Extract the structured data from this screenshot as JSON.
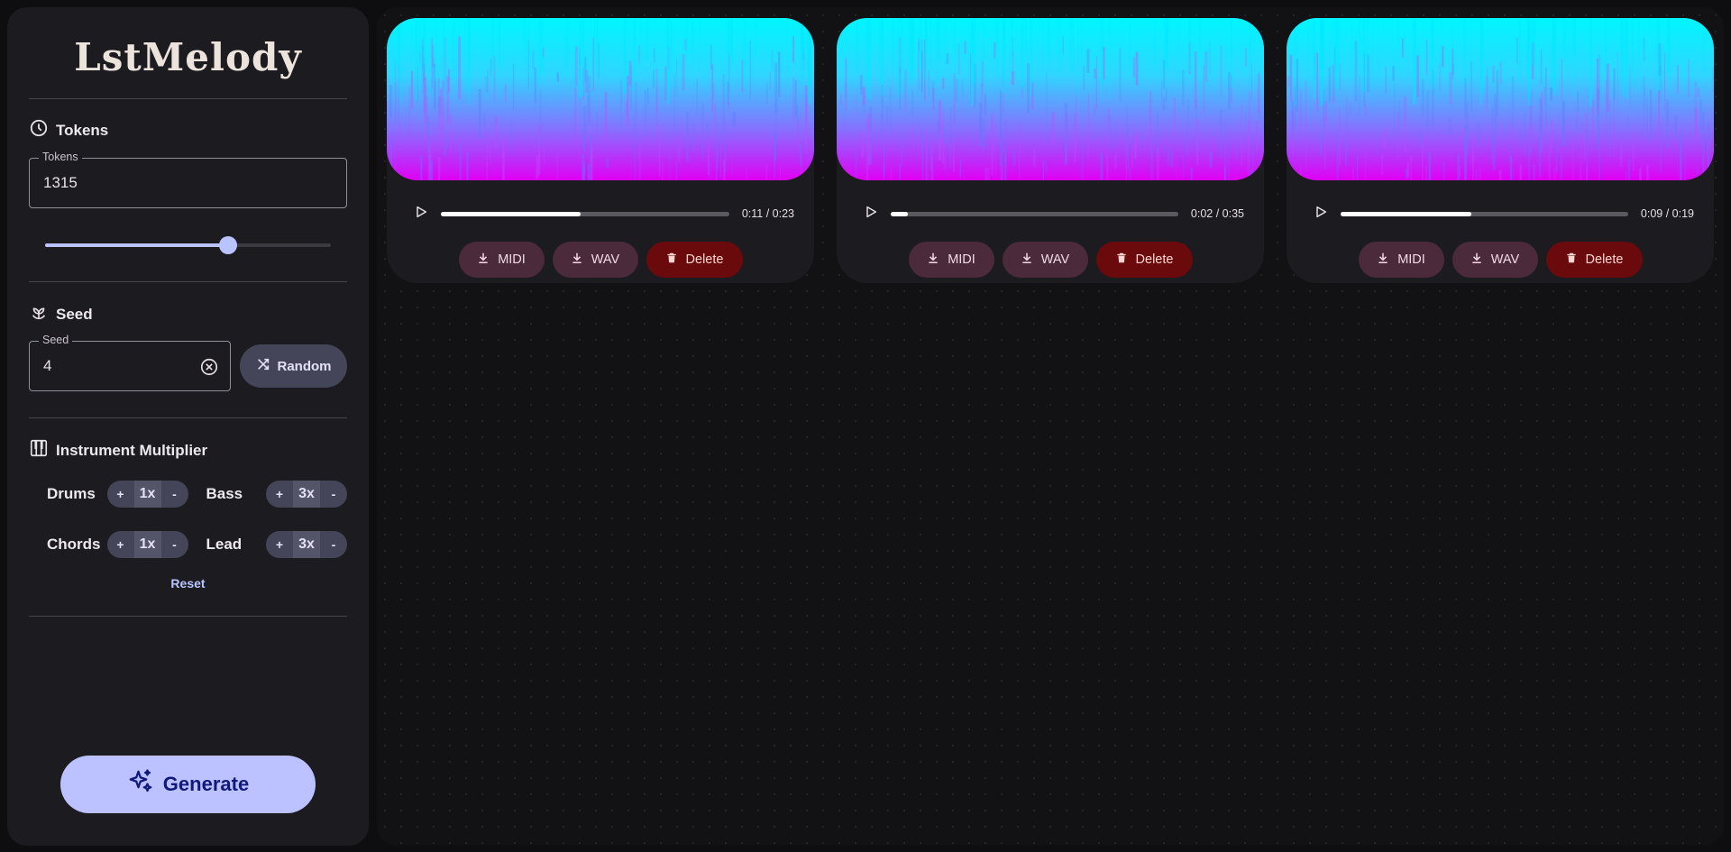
{
  "app": {
    "title": "LstMelody"
  },
  "tokens": {
    "heading": "Tokens",
    "field_label": "Tokens",
    "value": "1315",
    "slider_fraction": 0.64
  },
  "seed": {
    "heading": "Seed",
    "field_label": "Seed",
    "value": "4",
    "random_label": "Random"
  },
  "instruments": {
    "heading": "Instrument Multiplier",
    "items": [
      {
        "name": "Drums",
        "plus": "+",
        "value": "1x",
        "minus": "-"
      },
      {
        "name": "Bass",
        "plus": "+",
        "value": "3x",
        "minus": "-"
      },
      {
        "name": "Chords",
        "plus": "+",
        "value": "1x",
        "minus": "-"
      },
      {
        "name": "Lead",
        "plus": "+",
        "value": "3x",
        "minus": "-"
      }
    ],
    "reset_label": "Reset"
  },
  "generate": {
    "label": "Generate"
  },
  "tracks": [
    {
      "time": "0:11 / 0:23",
      "progress": 0.485,
      "midi_label": "MIDI",
      "wav_label": "WAV",
      "delete_label": "Delete"
    },
    {
      "time": "0:02 / 0:35",
      "progress": 0.06,
      "midi_label": "MIDI",
      "wav_label": "WAV",
      "delete_label": "Delete"
    },
    {
      "time": "0:09 / 0:19",
      "progress": 0.455,
      "midi_label": "MIDI",
      "wav_label": "WAV",
      "delete_label": "Delete"
    }
  ],
  "colors": {
    "accent": "#b9c3ff",
    "spectrogram_high": "#00f6ff",
    "spectrogram_low": "#e000f4",
    "delete": "#6a0a0c"
  },
  "icons": {
    "tokens": "clock-icon",
    "seed": "sprout-icon",
    "instruments": "piano-icon",
    "clear": "clear-circle-icon",
    "random": "shuffle-icon",
    "generate": "sparkle-icon",
    "play": "play-icon",
    "download": "download-icon",
    "delete": "trash-icon"
  }
}
